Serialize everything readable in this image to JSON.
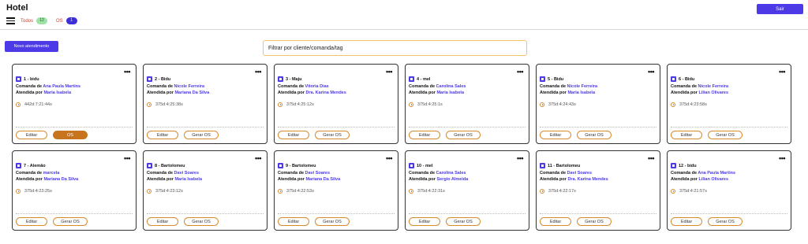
{
  "app": {
    "title": "Hotel",
    "logout_label": "Sair"
  },
  "filters": {
    "all_label": "Todos",
    "all_count": "12",
    "os_label": "OS",
    "os_count": "1"
  },
  "toolbar": {
    "new_label": "Novo atendimento",
    "search_placeholder": "Filtrar por cliente/comanda/tag"
  },
  "card_labels": {
    "comanda_prefix": "Comanda de",
    "atendida_prefix": "Atendida por",
    "edit_label": "Editar",
    "os_label": "OS",
    "gerar_os_label": "Gerar OS"
  },
  "cards": [
    {
      "title": "1 - bidu",
      "client": "Ana Paula Martins",
      "attendant": "Maria Isabela",
      "time": "442d:7:21:44s",
      "os_active": true
    },
    {
      "title": "2 - Bidu",
      "client": "Nicole Ferreira",
      "attendant": "Mariana Da Silva",
      "time": "375d:4:25:38s",
      "os_active": false
    },
    {
      "title": "3 - Maju",
      "client": "Vitoria Dias",
      "attendant": "Dra. Karina Mendes",
      "time": "375d:4:25:12s",
      "os_active": false
    },
    {
      "title": "4 - mel",
      "client": "Carolina Sales",
      "attendant": "Maria Isabela",
      "time": "375d:4:25:1s",
      "os_active": false
    },
    {
      "title": "5 - Bidu",
      "client": "Nicole Ferreira",
      "attendant": "Maria Isabela",
      "time": "375d:4:24:43s",
      "os_active": false
    },
    {
      "title": "6 - Bidu",
      "client": "Nicole Ferreira",
      "attendant": "Lilian Olivares",
      "time": "375d:4:23:58s",
      "os_active": false
    },
    {
      "title": "7 - Alemão",
      "client": "marcela",
      "attendant": "Mariana Da Silva",
      "time": "375d:4:23:25s",
      "os_active": false
    },
    {
      "title": "8 - Bartolomeu",
      "client": "Davi Soares",
      "attendant": "Maria Isabela",
      "time": "375d:4:23:12s",
      "os_active": false
    },
    {
      "title": "9 - Bartolomeu",
      "client": "Davi Soares",
      "attendant": "Mariana Da Silva",
      "time": "375d:4:22:53s",
      "os_active": false
    },
    {
      "title": "10 - mel",
      "client": "Carolina Sales",
      "attendant": "Sergio Almeida",
      "time": "375d:4:22:31s",
      "os_active": false
    },
    {
      "title": "11 - Bartolomeu",
      "client": "Davi Soares",
      "attendant": "Dra. Karina Mendes",
      "time": "375d:4:22:17s",
      "os_active": false
    },
    {
      "title": "12 - bidu",
      "client": "Ana Paula Martins",
      "attendant": "Lilian Olivares",
      "time": "375d:4:21:57s",
      "os_active": false
    }
  ]
}
